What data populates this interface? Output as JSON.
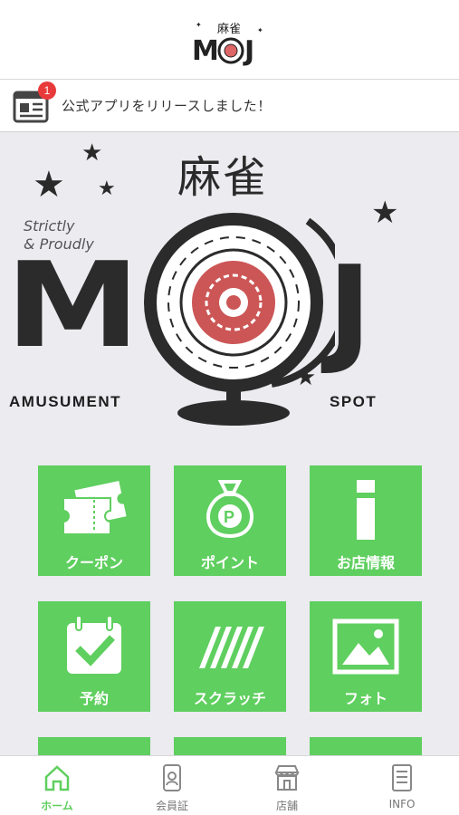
{
  "header": {
    "logo_kanji": "麻雀",
    "logo_text": "MOJ"
  },
  "news": {
    "badge_count": "1",
    "message": "公式アプリをリリースしました！"
  },
  "banner": {
    "kanji": "麻雀",
    "tagline_line1": "Strictly",
    "tagline_line2": "& Proudly",
    "letter_m": "M",
    "letter_j": "J",
    "left_caption": "AMUSUMENT",
    "right_caption": "SPOT"
  },
  "menu": {
    "coupon": "クーポン",
    "point": "ポイント",
    "shop_info": "お店情報",
    "reserve": "予約",
    "scratch": "スクラッチ",
    "photo": "フォト"
  },
  "tabbar": {
    "home": "ホーム",
    "member": "会員証",
    "store": "店舗",
    "info": "INFO"
  },
  "colors": {
    "accent_green": "#5fcf5f",
    "badge_red": "#e83a3a",
    "background": "#ebebf0"
  }
}
